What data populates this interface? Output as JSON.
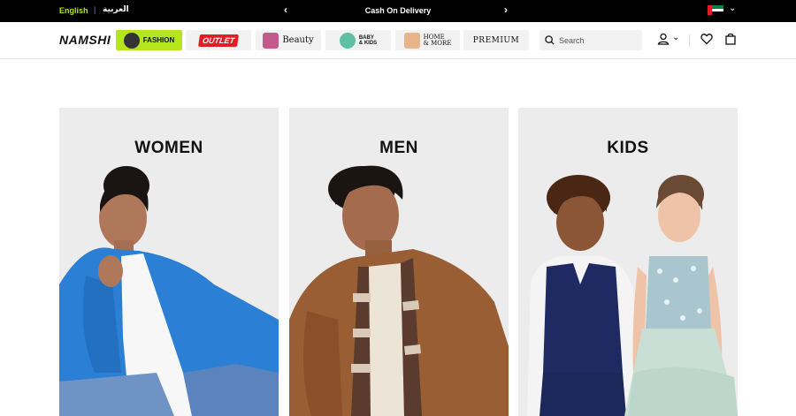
{
  "topbar": {
    "lang_en": "English",
    "separator": "|",
    "lang_ar": "العربية",
    "promo_text": "Cash On Delivery",
    "prev_icon": "chevron-left-icon",
    "next_icon": "chevron-right-icon",
    "country_flag": "uae-flag-icon",
    "colors": {
      "bg": "#000000",
      "active_lang": "#b5e61d"
    }
  },
  "header": {
    "logo": "NAMSHI",
    "categories": [
      {
        "label": "FASHION",
        "active": true
      },
      {
        "label": "OUTLET"
      },
      {
        "label": "Beauty"
      },
      {
        "label": "BABY & KIDS",
        "line1": "BABY",
        "line2": "& KIDS"
      },
      {
        "label": "HOME & MORE",
        "line1": "HOME",
        "line2": "& MORE"
      },
      {
        "label": "PREMIUM"
      }
    ],
    "search": {
      "placeholder": "Search"
    },
    "icons": [
      "search-icon",
      "user-icon",
      "chevron-down-icon",
      "heart-icon",
      "bag-icon"
    ],
    "colors": {
      "accent": "#b5e61d",
      "outlet_red": "#e01e24"
    }
  },
  "main": {
    "cards": [
      {
        "title": "WOMEN"
      },
      {
        "title": "MEN"
      },
      {
        "title": "KIDS"
      }
    ]
  }
}
